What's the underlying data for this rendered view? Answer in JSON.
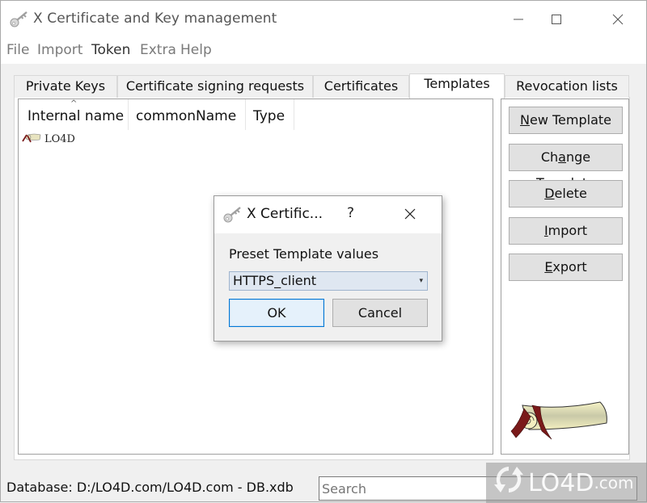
{
  "window": {
    "title": "X Certificate and Key management",
    "controls": {
      "minimize": "minimize-icon",
      "maximize": "maximize-icon",
      "close": "close-icon"
    }
  },
  "menu": {
    "items": [
      {
        "label": "File",
        "active": false
      },
      {
        "label": "Import",
        "active": false
      },
      {
        "label": "Token",
        "active": true
      },
      {
        "label": "Extra",
        "active": false
      },
      {
        "label": "Help",
        "active": false
      }
    ]
  },
  "tabs": [
    {
      "label": "Private Keys",
      "selected": false
    },
    {
      "label": "Certificate signing requests",
      "selected": false
    },
    {
      "label": "Certificates",
      "selected": false
    },
    {
      "label": "Templates",
      "selected": true
    },
    {
      "label": "Revocation lists",
      "selected": false
    }
  ],
  "list": {
    "columns": [
      "Internal name",
      "commonName",
      "Type"
    ],
    "sort_indicator": "^",
    "rows": [
      {
        "internal_name": "LO4D",
        "common_name": "",
        "type": "",
        "icon": "template-scroll-icon"
      }
    ]
  },
  "side_buttons": [
    {
      "label_pre": "",
      "mnemonic": "N",
      "label_post": "ew Template"
    },
    {
      "label_pre": "Ch",
      "mnemonic": "a",
      "label_post": "nge Template"
    },
    {
      "label_pre": "",
      "mnemonic": "D",
      "label_post": "elete"
    },
    {
      "label_pre": "",
      "mnemonic": "I",
      "label_post": "mport"
    },
    {
      "label_pre": "",
      "mnemonic": "E",
      "label_post": "xport"
    }
  ],
  "status": {
    "database_label": "Database: D:/LO4D.com/LO4D.com - DB.xdb",
    "search_placeholder": "Search",
    "search_value": ""
  },
  "dialog": {
    "title": "X Certific...",
    "help": "?",
    "label": "Preset Template values",
    "select_value": "HTTPS_client",
    "ok_label": "OK",
    "cancel_label": "Cancel"
  },
  "watermark": {
    "brand": "LO4D",
    "suffix": ".com"
  },
  "colors": {
    "accent": "#0078d7",
    "scroll_ribbon": "#7a1a1a",
    "scroll_paper": "#f3f0c0"
  }
}
